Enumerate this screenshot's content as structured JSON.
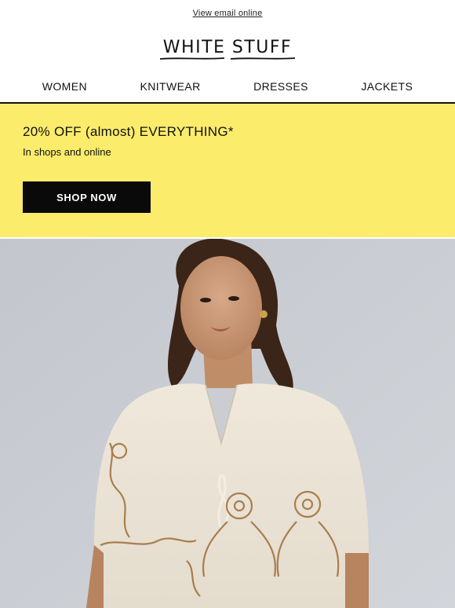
{
  "header": {
    "view_online": "View email online",
    "logo_text": "WHITE STUFF"
  },
  "nav": {
    "items": [
      "WOMEN",
      "KNITWEAR",
      "DRESSES",
      "JACKETS"
    ]
  },
  "promo": {
    "headline": "20% OFF (almost) EVERYTHING*",
    "subtext": "In shops and online",
    "cta": "SHOP NOW",
    "background": "#fbec6b"
  },
  "hero": {
    "alt": "Model wearing cream embroidered tie-front blouse"
  }
}
